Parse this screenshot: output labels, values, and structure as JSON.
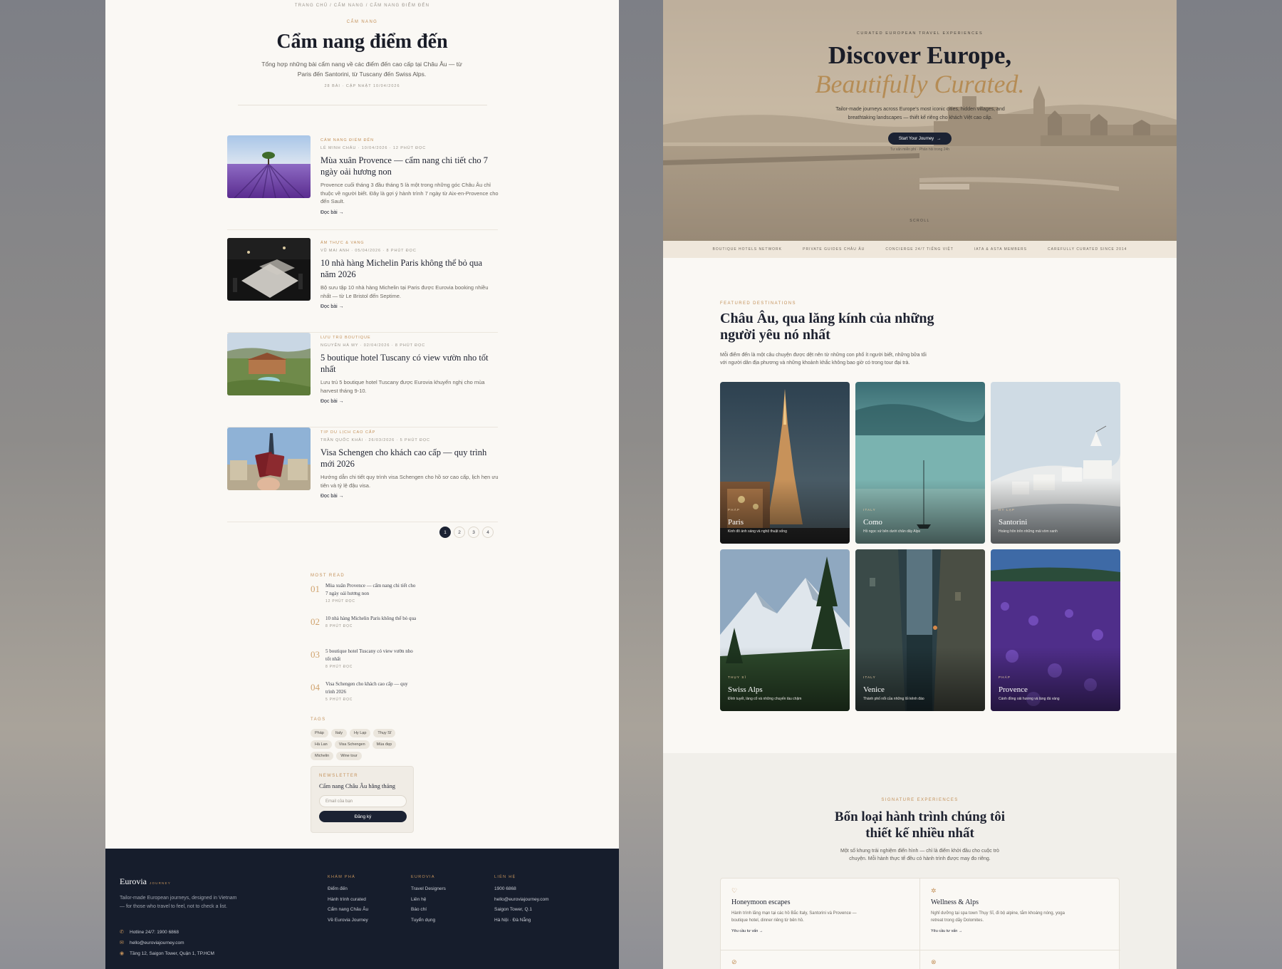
{
  "left": {
    "breadcrumb": "TRANG CHỦ / CẨM NANG / CẨM NANG ĐIỂM ĐẾN",
    "eyebrow": "CẨM NANG",
    "title": "Cẩm nang điểm đến",
    "description": "Tổng hợp những bài cẩm nang về các điểm đến cao cấp tại Châu Âu — từ Paris đến Santorini, từ Tuscany đến Swiss Alps.",
    "meta": "28 BÀI · CẬP NHẬT 10/04/2026",
    "articles": [
      {
        "category": "CẨM NANG ĐIỂM ĐẾN",
        "meta": "LÊ MINH CHÂU · 10/04/2026 · 12 PHÚT ĐỌC",
        "title": "Mùa xuân Provence — cẩm nang chi tiết cho 7 ngày oải hương non",
        "excerpt": "Provence cuối tháng 3 đầu tháng 5 là một trong những góc Châu Âu chỉ thuộc về người biết. Đây là gợi ý hành trình 7 ngày từ Aix-en-Provence cho đến Sault.",
        "link": "Đọc bài →"
      },
      {
        "category": "ẨM THỰC & VANG",
        "meta": "VŨ MAI ANH · 05/04/2026 · 8 PHÚT ĐỌC",
        "title": "10 nhà hàng Michelin Paris không thể bỏ qua năm 2026",
        "excerpt": "Bộ sưu tập 10 nhà hàng Michelin tại Paris được Eurovia booking nhiều nhất — từ Le Bristol đến Septime.",
        "link": "Đọc bài →"
      },
      {
        "category": "LƯU TRÚ BOUTIQUE",
        "meta": "NGUYỄN HÀ MY · 02/04/2026 · 8 PHÚT ĐỌC",
        "title": "5 boutique hotel Tuscany có view vườn nho tốt nhất",
        "excerpt": "Lưu trú 5 boutique hotel Tuscany được Eurovia khuyến nghị cho mùa harvest tháng 9-10.",
        "link": "Đọc bài →"
      },
      {
        "category": "TIP DU LỊCH CAO CẤP",
        "meta": "TRẦN QUỐC KHẢI · 26/03/2026 · 5 PHÚT ĐỌC",
        "title": "Visa Schengen cho khách cao cấp — quy trình mới 2026",
        "excerpt": "Hướng dẫn chi tiết quy trình visa Schengen cho hồ sơ cao cấp, lịch hẹn ưu tiên và tỷ lệ đậu visa.",
        "link": "Đọc bài →"
      }
    ],
    "pages": [
      "1",
      "2",
      "3",
      "4"
    ],
    "most_read_label": "MOST READ",
    "most_read": [
      {
        "num": "01",
        "title": "Mùa xuân Provence — cẩm nang chi tiết cho 7 ngày oải hương non",
        "meta": "12 PHÚT ĐỌC"
      },
      {
        "num": "02",
        "title": "10 nhà hàng Michelin Paris không thể bỏ qua",
        "meta": "8 PHÚT ĐỌC"
      },
      {
        "num": "03",
        "title": "5 boutique hotel Tuscany có view vườn nho tốt nhất",
        "meta": "8 PHÚT ĐỌC"
      },
      {
        "num": "04",
        "title": "Visa Schengen cho khách cao cấp — quy trình 2026",
        "meta": "5 PHÚT ĐỌC"
      }
    ],
    "tags_label": "TAGS",
    "tags": [
      "Pháp",
      "Italy",
      "Hy Lạp",
      "Thụy Sĩ",
      "Hà Lan",
      "Visa Schengen",
      "Mùa đẹp",
      "Michelin",
      "Wine tour"
    ],
    "newsletter": {
      "label": "NEWSLETTER",
      "title": "Cẩm nang Châu Âu hằng tháng",
      "placeholder": "Email của bạn",
      "button": "Đăng ký"
    },
    "footer": {
      "brand": "Eurovia",
      "brand_sub": "JOURNEY",
      "description": "Tailor-made European journeys, designed in Vietnam — for those who travel to feel, not to check a list.",
      "hotline": "Hotline 24/7: 1900 6868",
      "email": "hello@euroviajourney.com",
      "address": "Tầng 12, Saigon Tower, Quận 1, TP.HCM",
      "columns": [
        {
          "title": "KHÁM PHÁ",
          "links": [
            "Điểm đến",
            "Hành trình curated",
            "Cẩm nang Châu Âu",
            "Về Eurovia Journey"
          ]
        },
        {
          "title": "EUROVIA",
          "links": [
            "Travel Designers",
            "Liên hệ",
            "Báo chí",
            "Tuyển dụng"
          ]
        },
        {
          "title": "LIÊN HỆ",
          "links": [
            "1900 6868",
            "hello@euroviajourney.com",
            "Saigon Tower, Q.1",
            "Hà Nội · Đà Nẵng"
          ]
        }
      ]
    }
  },
  "right": {
    "hero": {
      "eyebrow": "CURATED EUROPEAN TRAVEL EXPERIENCES",
      "title": "Discover Europe,",
      "title_accent": "Beautifully Curated.",
      "description": "Tailor-made journeys across Europe's most iconic cities, hidden villages, and breathtaking landscapes — thiết kế riêng cho khách Việt cao cấp.",
      "button": "Start Your Journey",
      "sub": "Tư vấn miễn phí · Phản hồi trong 24h",
      "scroll": "SCROLL"
    },
    "trust": [
      "BOUTIQUE HOTELS NETWORK",
      "PRIVATE GUIDES CHÂU ÂU",
      "CONCIERGE 24/7 TIẾNG VIỆT",
      "IATA & ASTA MEMBERS",
      "CAREFULLY CURATED SINCE 2014"
    ],
    "destinations": {
      "eyebrow": "FEATURED DESTINATIONS",
      "title": "Châu Âu, qua lăng kính của những người yêu nó nhất",
      "description": "Mỗi điểm đến là một câu chuyện được dệt nên từ những con phố ít người biết, những bữa tối với người dân địa phương và những khoảnh khắc không bao giờ có trong tour đại trà.",
      "items": [
        {
          "country": "PHÁP",
          "name": "Paris",
          "sub": "Kinh đô ánh sáng và nghệ thuật sống"
        },
        {
          "country": "ITALY",
          "name": "Como",
          "sub": "Hồ ngọc xứ bên dưới chân dãy Alps"
        },
        {
          "country": "HY LẠP",
          "name": "Santorini",
          "sub": "Hoàng hôn trên những mái vòm xanh"
        },
        {
          "country": "THỤY SĨ",
          "name": "Swiss Alps",
          "sub": "Đỉnh tuyết, làng cổ và những chuyến tàu chậm"
        },
        {
          "country": "ITALY",
          "name": "Venice",
          "sub": "Thành phố nổi của những lối kênh đào"
        },
        {
          "country": "PHÁP",
          "name": "Provence",
          "sub": "Cánh đồng oải hương và làng đá vàng"
        }
      ]
    },
    "signature": {
      "eyebrow": "SIGNATURE EXPERIENCES",
      "title": "Bốn loại hành trình chúng tôi thiết kế nhiều nhất",
      "description": "Một số khung trải nghiệm điển hình — chỉ là điểm khởi đầu cho cuộc trò chuyện. Mỗi hành thực tế đều có hành trình được may đo riêng.",
      "items": [
        {
          "name": "Honeymoon escapes",
          "text": "Hành trình lãng mạn tại các hồ Bắc Italy, Santorini và Provence — boutique hotel, dinner riêng từ bên hồ.",
          "link": "Yêu cầu tư vấn →"
        },
        {
          "name": "Wellness & Alps",
          "text": "Nghỉ dưỡng tại spa town Thụy Sĩ, đi bộ alpine, tắm khoáng nóng, yoga retreat trong dãy Dolomites.",
          "link": "Yêu cầu tư vấn →"
        }
      ]
    }
  }
}
